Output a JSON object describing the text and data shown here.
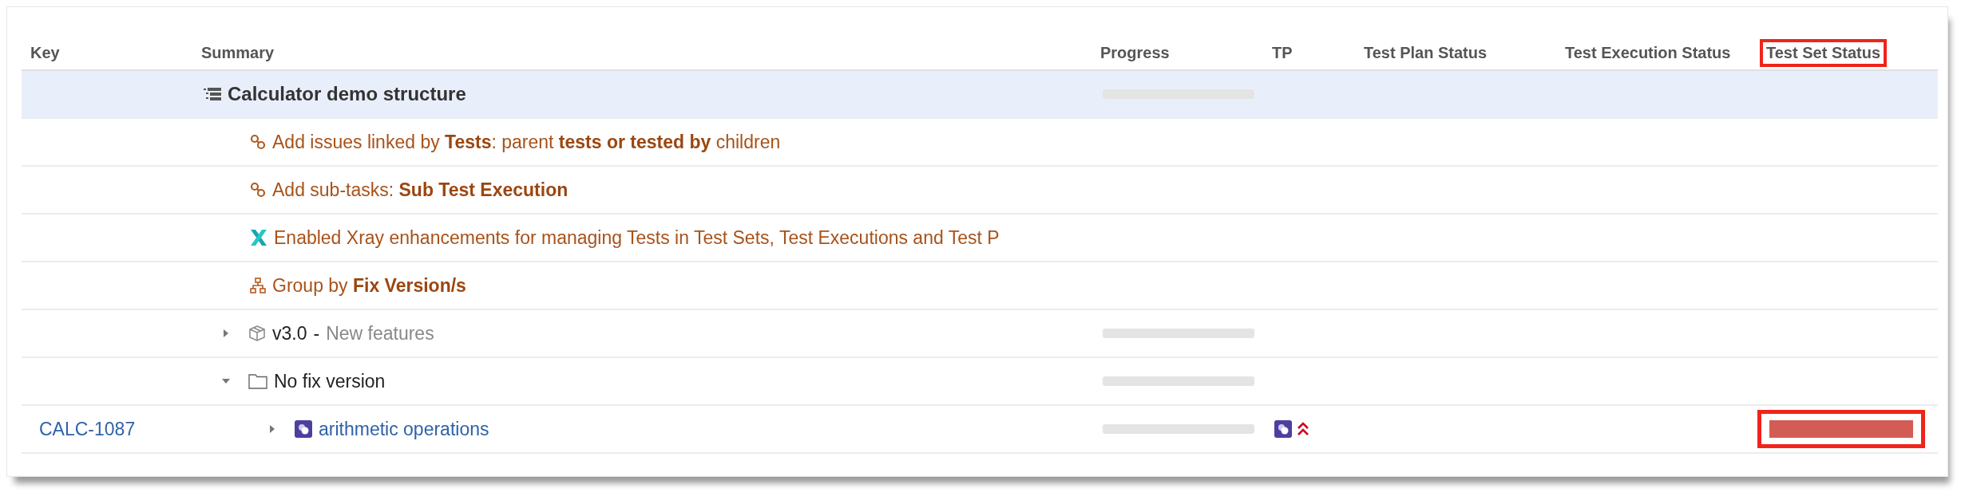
{
  "table": {
    "columns": [
      {
        "label": "Key",
        "highlighted": false
      },
      {
        "label": "Summary",
        "highlighted": false
      },
      {
        "label": "Progress",
        "highlighted": false
      },
      {
        "label": "TP",
        "highlighted": false
      },
      {
        "label": "Test Plan Status",
        "highlighted": false
      },
      {
        "label": "Test Execution Status",
        "highlighted": false
      },
      {
        "label": "Test Set Status",
        "highlighted": true
      }
    ],
    "rows": [
      {
        "kind": "structure",
        "title": "Calculator demo structure",
        "selected": true,
        "progress": {
          "level": 0
        },
        "children": [
          {
            "kind": "link-generator",
            "parts": [
              "Add issues linked by **Tests**: parent **tests or tested by** children"
            ]
          },
          {
            "kind": "link-generator",
            "parts": [
              "Add sub-tasks: **Sub Test Execution**"
            ]
          },
          {
            "kind": "xray-generator",
            "parts": [
              "Enabled Xray enhancements for managing Tests in Test Sets, Test Executions and Test P"
            ]
          },
          {
            "kind": "group-generator",
            "parts": [
              "Group by **Fix Version/s**"
            ]
          },
          {
            "kind": "version",
            "title": "v3.0",
            "separator": "-",
            "description": "New features",
            "expanded": false,
            "progress": {
              "level": 0
            }
          },
          {
            "kind": "folder",
            "title": "No fix version",
            "expanded": true,
            "progress": {
              "level": 0
            },
            "children": [
              {
                "kind": "issue",
                "key": "CALC-1087",
                "title": "arithmetic operations",
                "expanded": false,
                "progress": {
                  "level": 0
                },
                "tp": {
                  "high_priority": true
                },
                "test_set_status": {
                  "level": 1,
                  "highlighted": true
                }
              }
            ]
          }
        ]
      }
    ]
  }
}
